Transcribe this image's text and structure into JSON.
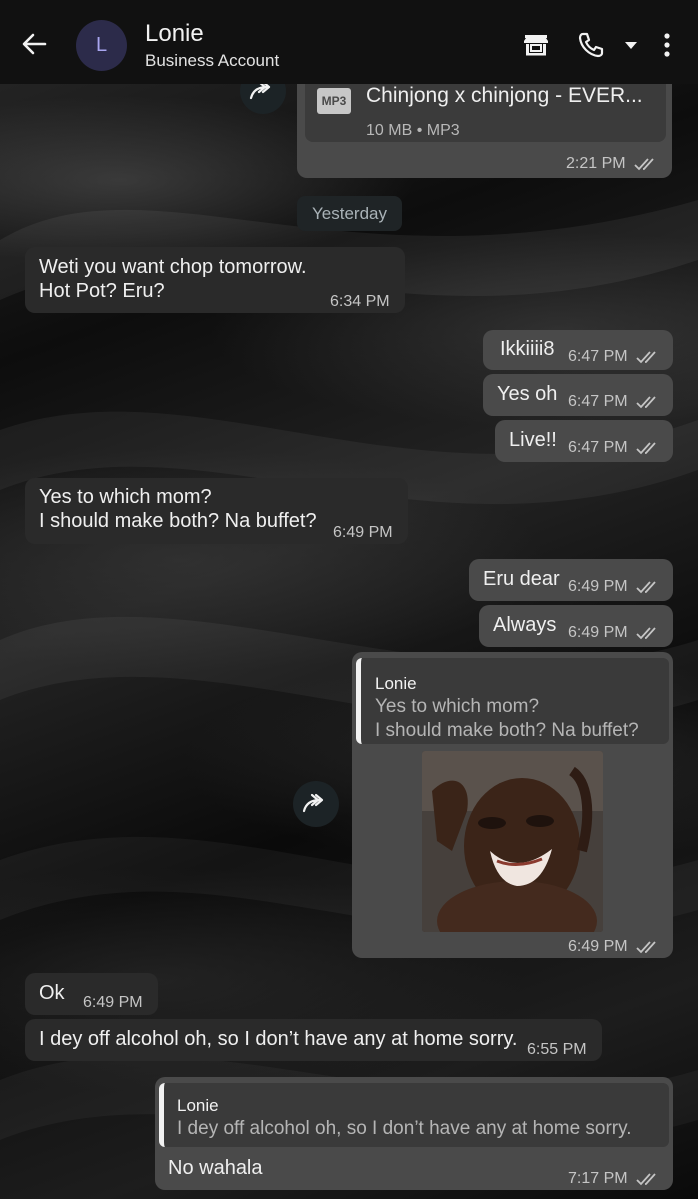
{
  "header": {
    "contact_name": "Lonie",
    "contact_subtitle": "Business Account",
    "avatar_initial": "L"
  },
  "file_message": {
    "badge": "MP3",
    "file_name": "Chinjong x chinjong - EVER...",
    "file_meta": "10 MB • MP3",
    "time": "2:21 PM"
  },
  "date_separator": "Yesterday",
  "messages": [
    {
      "direction": "in",
      "lines": [
        "Weti you want chop tomorrow.",
        "Hot Pot? Eru?"
      ],
      "time": "6:34 PM"
    },
    {
      "direction": "out",
      "lines": [
        "Ikkiiii8"
      ],
      "time": "6:47 PM"
    },
    {
      "direction": "out",
      "lines": [
        "Yes oh"
      ],
      "time": "6:47 PM"
    },
    {
      "direction": "out",
      "lines": [
        "Live!!"
      ],
      "time": "6:47 PM"
    },
    {
      "direction": "in",
      "lines": [
        "Yes to which mom?",
        "I should make both? Na buffet?"
      ],
      "time": "6:49 PM"
    },
    {
      "direction": "out",
      "lines": [
        "Eru dear"
      ],
      "time": "6:49 PM"
    },
    {
      "direction": "out",
      "lines": [
        "Always"
      ],
      "time": "6:49 PM"
    },
    {
      "direction": "out",
      "reply_to_name": "Lonie",
      "reply_to_lines": [
        "Yes to which mom?",
        "I should make both? Na buffet?"
      ],
      "time": "6:49 PM"
    },
    {
      "direction": "in",
      "lines": [
        "Ok"
      ],
      "time": "6:49 PM"
    },
    {
      "direction": "in",
      "lines": [
        "I dey off alcohol oh, so I don’t have any at home sorry."
      ],
      "time": "6:55 PM"
    },
    {
      "direction": "out",
      "reply_to_name": "Lonie",
      "reply_to_lines": [
        "I dey off alcohol oh, so I don’t have any at home sorry."
      ],
      "lines": [
        "No wahala"
      ],
      "time": "7:17 PM"
    }
  ],
  "icons": {
    "back": "arrow-left-icon",
    "store": "storefront-icon",
    "call": "phone-icon",
    "call_dropdown": "caret-down-icon",
    "menu": "more-vertical-icon",
    "forward": "forward-icon",
    "read_receipt": "double-check-icon"
  },
  "colors": {
    "incoming_bubble": "#2a2a2a",
    "outgoing_bubble": "#4a4a4a",
    "header_bg": "#111111",
    "avatar_bg": "#2c2b4a"
  }
}
